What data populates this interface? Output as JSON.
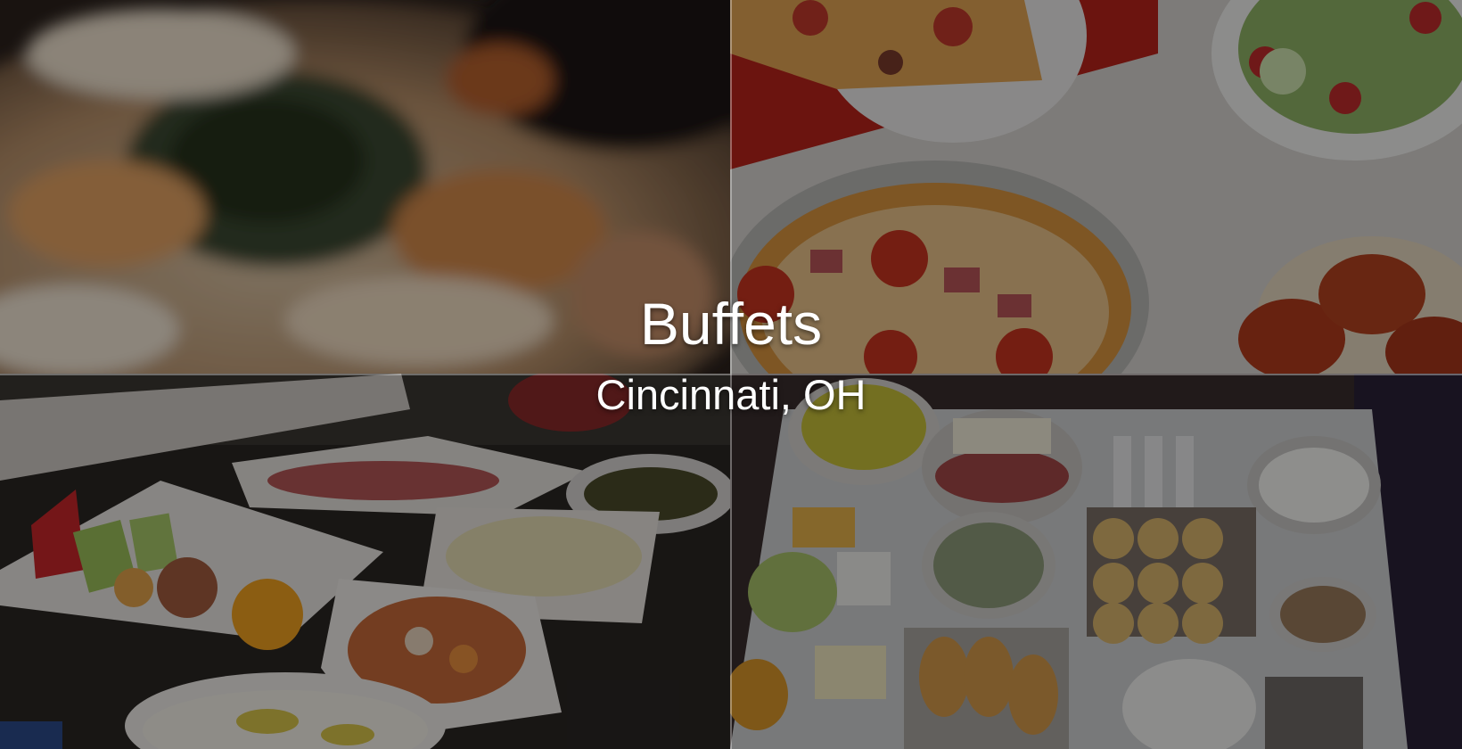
{
  "hero": {
    "title": "Buffets",
    "subtitle": "Cincinnati, OH"
  },
  "tiles": [
    {
      "name": "tile-noodle-dish",
      "icon": "food-photo-noodles"
    },
    {
      "name": "tile-pizza-salad",
      "icon": "food-photo-pizza"
    },
    {
      "name": "tile-hotel-buffet",
      "icon": "food-photo-buffet-trays"
    },
    {
      "name": "tile-breakfast-spread",
      "icon": "food-photo-breakfast"
    }
  ],
  "colors": {
    "overlay": "#000000",
    "text": "#ffffff",
    "pizza-red": "#c8261c",
    "cheese": "#e8a544"
  }
}
